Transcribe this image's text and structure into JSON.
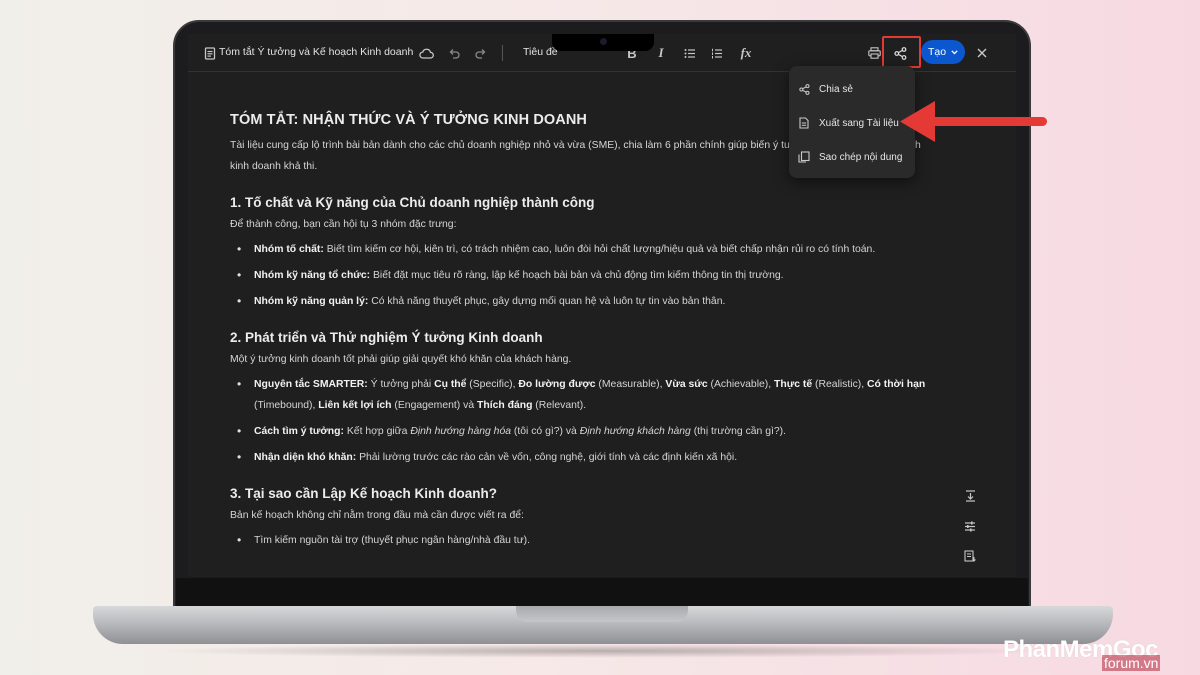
{
  "toolbar": {
    "doc_title": "Tóm tắt Ý tưởng và Kế hoạch Kinh doanh",
    "style_select": "Tiêu đề",
    "create_label": "Tạo"
  },
  "share_menu": {
    "items": [
      {
        "label": "Chia sẻ",
        "icon": "share-icon"
      },
      {
        "label": "Xuất sang Tài liệu",
        "icon": "doc-icon"
      },
      {
        "label": "Sao chép nội dung",
        "icon": "copy-icon"
      }
    ]
  },
  "document": {
    "title": "TÓM TẮT: NHẬN THỨC VÀ Ý TƯỞNG KINH DOANH",
    "intro": "Tài liệu cung cấp lộ trình bài bản dành cho các chủ doanh nghiệp nhỏ và vừa (SME), chia làm 6 phần chính giúp biến ý tưởng thô thành một kế hoạch kinh doanh khả thi.",
    "section1": {
      "heading": "1. Tố chất và Kỹ năng của Chủ doanh nghiệp thành công",
      "lead": "Để thành công, bạn cần hội tụ 3 nhóm đặc trưng:",
      "items": [
        {
          "bold": "Nhóm tố chất:",
          "text": " Biết tìm kiếm cơ hội, kiên trì, có trách nhiệm cao, luôn đòi hỏi chất lượng/hiệu quả và biết chấp nhận rủi ro có tính toán."
        },
        {
          "bold": "Nhóm kỹ năng tổ chức:",
          "text": " Biết đặt mục tiêu rõ ràng, lập kế hoạch bài bản và chủ động tìm kiếm thông tin thị trường."
        },
        {
          "bold": "Nhóm kỹ năng quản lý:",
          "text": " Có khả năng thuyết phục, gây dựng mối quan hệ và luôn tự tin vào bản thân."
        }
      ]
    },
    "section2": {
      "heading": "2. Phát triển và Thử nghiệm Ý tưởng Kinh doanh",
      "lead": "Một ý tưởng kinh doanh tốt phải giúp giải quyết khó khăn của khách hàng.",
      "smarter": {
        "label": "Nguyên tắc SMARTER:",
        "t1": " Ý tưởng phải ",
        "b1": "Cụ thể",
        "t2": " (Specific), ",
        "b2": "Đo lường được",
        "t3": " (Measurable), ",
        "b3": "Vừa sức",
        "t4": " (Achievable), ",
        "b4": "Thực tế",
        "t5": " (Realistic), ",
        "b5": "Có thời hạn",
        "t6": " (Timebound), ",
        "b6": "Liên kết lợi ích",
        "t7": " (Engagement) và ",
        "b7": "Thích đáng",
        "t8": " (Relevant)."
      },
      "find": {
        "label": "Cách tìm ý tưởng:",
        "t1": " Kết hợp giữa ",
        "i1": "Định hướng hàng hóa",
        "t2": " (tôi có gì?) và ",
        "i2": "Định hướng khách hàng",
        "t3": " (thị trường cần gì?)."
      },
      "barriers": {
        "label": "Nhận diện khó khăn:",
        "text": " Phải lường trước các rào cản về vốn, công nghệ, giới tính và các định kiến xã hội."
      }
    },
    "section3": {
      "heading": "3. Tại sao cần Lập Kế hoạch Kinh doanh?",
      "lead": "Bản kế hoạch không chỉ nằm trong đầu mà cần được viết ra để:",
      "items": [
        {
          "text": "Tìm kiếm nguồn tài trợ (thuyết phục ngân hàng/nhà đầu tư)."
        }
      ]
    }
  },
  "watermark": {
    "brand": "PhanMemGoc",
    "sub": "forum.vn"
  },
  "colors": {
    "highlight": "#e53935",
    "create_button": "#0b57d0",
    "screen_bg": "#1f1f1f"
  }
}
